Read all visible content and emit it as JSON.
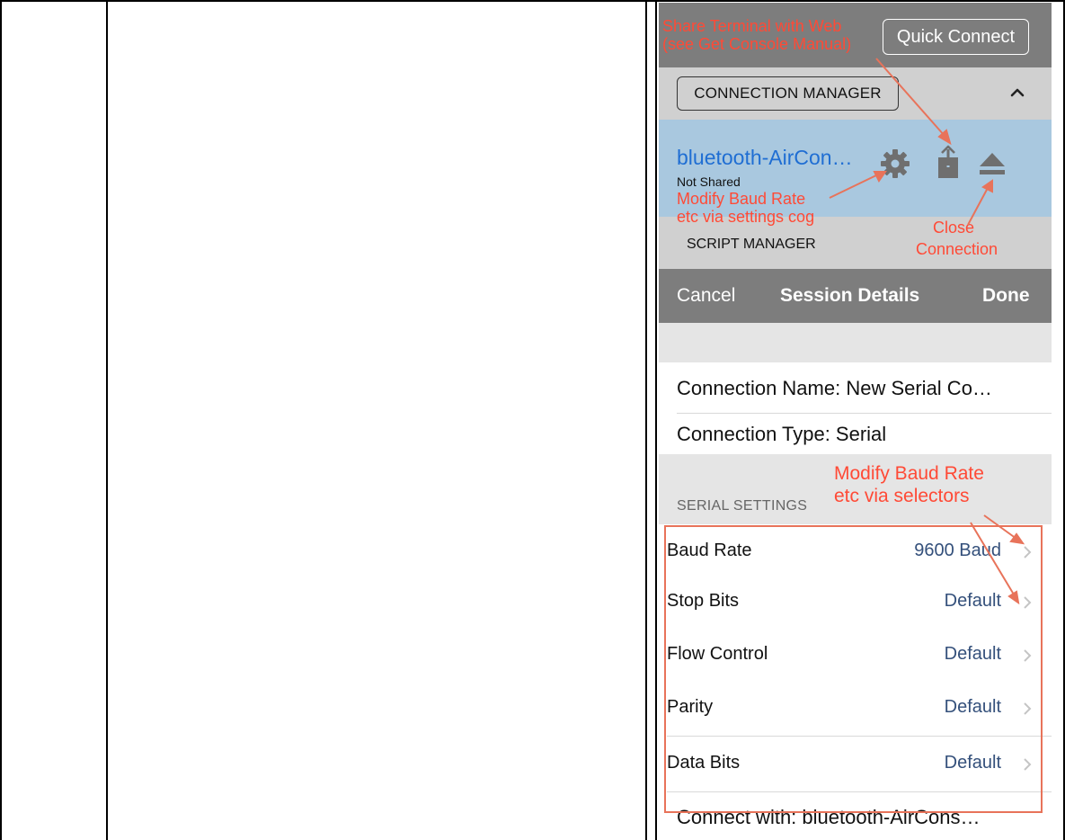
{
  "top_bar": {
    "quick_connect": "Quick Connect"
  },
  "connection_manager": {
    "label": "CONNECTION MANAGER"
  },
  "connection": {
    "name": "bluetooth-AirCon…",
    "status": "Not Shared"
  },
  "script_manager": {
    "label": "SCRIPT MANAGER"
  },
  "nav": {
    "cancel": "Cancel",
    "title": "Session Details",
    "done": "Done"
  },
  "details": {
    "connection_name": "Connection Name: New Serial Co…",
    "connection_type": "Connection Type: Serial",
    "connect_with": "Connect with: bluetooth-AirCons…"
  },
  "serial_settings": {
    "header": "SERIAL SETTINGS",
    "rows": [
      {
        "label": "Baud Rate",
        "value": "9600 Baud"
      },
      {
        "label": "Stop Bits",
        "value": "Default"
      },
      {
        "label": "Flow Control",
        "value": "Default"
      },
      {
        "label": "Parity",
        "value": "Default"
      },
      {
        "label": "Data Bits",
        "value": "Default"
      }
    ]
  },
  "annotations": {
    "share_line1": "Share Terminal with Web",
    "share_line2": "(see Get Console Manual)",
    "cog_line1": "Modify Baud Rate",
    "cog_line2": "etc via settings cog",
    "close_line1": "Close",
    "close_line2": "Connection",
    "selectors_line1": "Modify Baud Rate",
    "selectors_line2": "etc via selectors"
  },
  "colors": {
    "annotation": "#ff4a36",
    "link_blue": "#1f6ed3",
    "value_blue": "#34507b",
    "bar_gray": "#7d7d7d",
    "selected_row": "#a9c8df"
  }
}
